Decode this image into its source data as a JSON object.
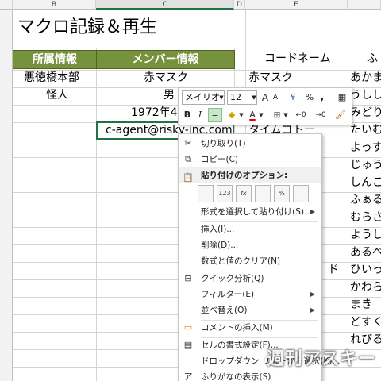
{
  "colors": {
    "header_fill": "#76923c",
    "accent": "#217346"
  },
  "title": "マクロ記録＆再生",
  "columns": {
    "b": "B",
    "c": "C",
    "d": "D",
    "e": "E"
  },
  "headers": {
    "affiliation": "所属情報",
    "member": "メンバー情報",
    "codename": "コードネーム",
    "next": "ふ"
  },
  "cells": {
    "b3": "悪徳橋本部",
    "c3": "赤マスク",
    "e3": "赤マスク",
    "f3": "あかま",
    "b4": "怪人",
    "c4": "男",
    "f4": "うしし",
    "c5": "1972年4月",
    "f5": "みどり",
    "c6": "c-agent@risky-inc.com",
    "e6": "タイムゴトー",
    "f6": "たいむ",
    "f7": "よっす",
    "f8": "じゅう",
    "f9": "しんこ",
    "f10": "ふぁる",
    "f11": "むらさ",
    "f12": "ようし",
    "f13": "あるべ",
    "e14": "ド",
    "f14": "ひいっ",
    "f15": "かわら",
    "f16": "まき",
    "f17": "どすく",
    "f18": "れびる"
  },
  "mini_toolbar": {
    "font": "メイリオ",
    "size": "12",
    "grow": "A",
    "shrink": "A",
    "currency": "¥",
    "percent": "%",
    "comma": ",",
    "bold": "B",
    "italic": "I",
    "font_color": "A",
    "dec_inc": "←0",
    "dec_dec": "→0"
  },
  "context_menu": {
    "cut": "切り取り(T)",
    "copy": "コピー(C)",
    "paste_options": "貼り付けのオプション:",
    "paste_labels": [
      "",
      "123",
      "fx",
      "",
      "%",
      ""
    ],
    "paste_special": "形式を選択して貼り付け(S)...",
    "insert": "挿入(I)...",
    "delete": "削除(D)...",
    "clear": "数式と値のクリア(N)",
    "quick_analysis": "クイック分析(Q)",
    "filter": "フィルター(E)",
    "sort": "並べ替え(O)",
    "insert_comment": "コメントの挿入(M)",
    "format_cells": "セルの書式設定(F)...",
    "dropdown": "ドロップダウン リストから選択(K)...",
    "phonetic": "ふりがなの表示(S)"
  },
  "watermark": "週刊アスキー"
}
